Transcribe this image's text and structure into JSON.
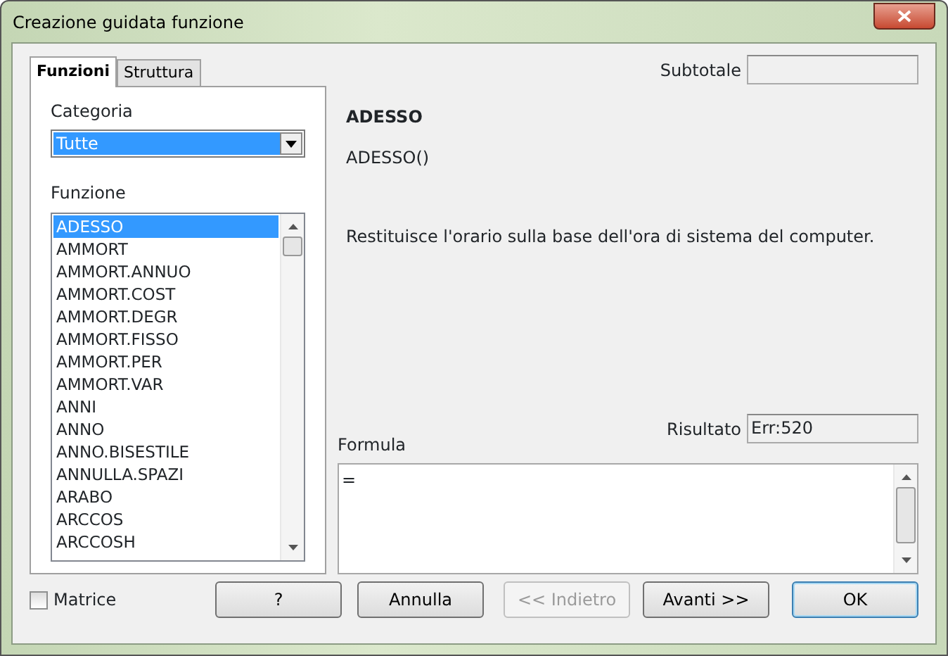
{
  "window": {
    "title": "Creazione guidata funzione"
  },
  "tabs": [
    {
      "label": "Funzioni",
      "selected": true
    },
    {
      "label": "Struttura",
      "selected": false
    }
  ],
  "category": {
    "label": "Categoria",
    "value": "Tutte"
  },
  "functions": {
    "label": "Funzione",
    "items": [
      {
        "label": "ADESSO",
        "selected": true
      },
      {
        "label": "AMMORT",
        "selected": false
      },
      {
        "label": "AMMORT.ANNUO",
        "selected": false
      },
      {
        "label": "AMMORT.COST",
        "selected": false
      },
      {
        "label": "AMMORT.DEGR",
        "selected": false
      },
      {
        "label": "AMMORT.FISSO",
        "selected": false
      },
      {
        "label": "AMMORT.PER",
        "selected": false
      },
      {
        "label": "AMMORT.VAR",
        "selected": false
      },
      {
        "label": "ANNI",
        "selected": false
      },
      {
        "label": "ANNO",
        "selected": false
      },
      {
        "label": "ANNO.BISESTILE",
        "selected": false
      },
      {
        "label": "ANNULLA.SPAZI",
        "selected": false
      },
      {
        "label": "ARABO",
        "selected": false
      },
      {
        "label": "ARCCOS",
        "selected": false
      },
      {
        "label": "ARCCOSH",
        "selected": false
      }
    ]
  },
  "subtotal": {
    "label": "Subtotale"
  },
  "function_name": "ADESSO",
  "function_syntax": "ADESSO()",
  "description": "Restituisce l'orario sulla base dell'ora di sistema del computer.",
  "result": {
    "label": "Risultato",
    "value": "Err:520"
  },
  "formula": {
    "label": "Formula",
    "value": "="
  },
  "array": {
    "label": "Matrice",
    "checked": false
  },
  "buttons": [
    {
      "label": "?",
      "disabled": false,
      "default": false
    },
    {
      "label": "Annulla",
      "disabled": false,
      "default": false
    },
    {
      "label": "<< Indietro",
      "disabled": true,
      "default": false
    },
    {
      "label": "Avanti >>",
      "disabled": false,
      "default": false
    },
    {
      "label": "OK",
      "disabled": false,
      "default": true
    }
  ]
}
